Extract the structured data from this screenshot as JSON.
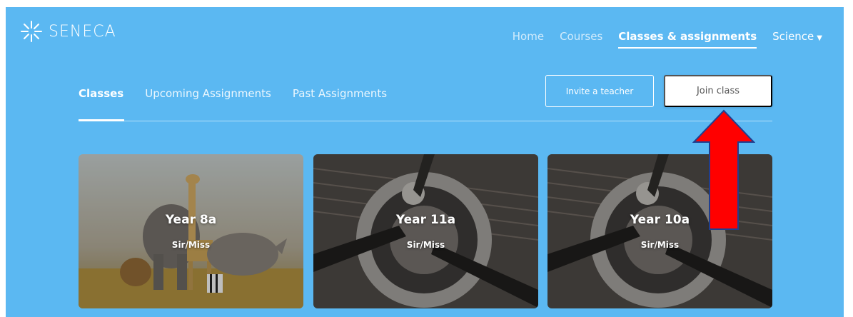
{
  "brand": {
    "name": "SENECA",
    "logo_icon": "sparkle-icon"
  },
  "topnav": {
    "items": [
      {
        "label": "Home"
      },
      {
        "label": "Courses"
      },
      {
        "label": "Classes & assignments"
      },
      {
        "label": "Science"
      }
    ],
    "active_index": 2
  },
  "subtabs": {
    "items": [
      {
        "label": "Classes"
      },
      {
        "label": "Upcoming Assignments"
      },
      {
        "label": "Past Assignments"
      }
    ],
    "active_index": 0
  },
  "actions": {
    "invite_label": "Invite a teacher",
    "join_label": "Join class"
  },
  "classes": [
    {
      "title": "Year 8a",
      "teacher": "Sir/Miss",
      "image": "safari-animals"
    },
    {
      "title": "Year 11a",
      "teacher": "Sir/Miss",
      "image": "aircraft-propeller"
    },
    {
      "title": "Year 10a",
      "teacher": "Sir/Miss",
      "image": "aircraft-propeller"
    }
  ],
  "colors": {
    "background": "#5bb8f2",
    "arrow_fill": "#ff0000",
    "arrow_stroke": "#1f3f8f"
  }
}
